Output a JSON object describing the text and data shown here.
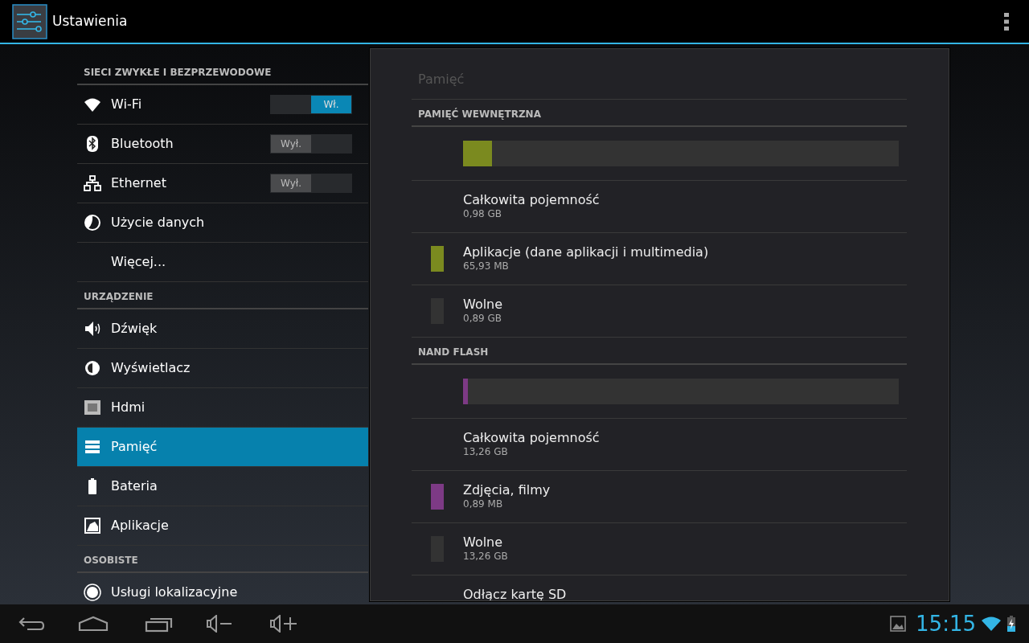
{
  "app_bar": {
    "title": "Ustawienia"
  },
  "sidebar": {
    "sections": [
      {
        "header": "SIECI ZWYKŁE I BEZPRZEWODOWE",
        "items": [
          {
            "label": "Wi-Fi",
            "selected": false,
            "toggle": {
              "on": true,
              "label": "Wł."
            }
          },
          {
            "label": "Bluetooth",
            "selected": false,
            "toggle": {
              "on": false,
              "label": "Wył."
            }
          },
          {
            "label": "Ethernet",
            "selected": false,
            "toggle": {
              "on": false,
              "label": "Wył."
            }
          },
          {
            "label": "Użycie danych",
            "selected": false
          },
          {
            "label": "Więcej...",
            "selected": false
          }
        ]
      },
      {
        "header": "URZĄDZENIE",
        "items": [
          {
            "label": "Dźwięk",
            "selected": false
          },
          {
            "label": "Wyświetlacz",
            "selected": false
          },
          {
            "label": "Hdmi",
            "selected": false
          },
          {
            "label": "Pamięć",
            "selected": true
          },
          {
            "label": "Bateria",
            "selected": false
          },
          {
            "label": "Aplikacje",
            "selected": false
          }
        ]
      },
      {
        "header": "OSOBISTE",
        "items": [
          {
            "label": "Usługi lokalizacyjne",
            "selected": false
          }
        ]
      }
    ]
  },
  "detail": {
    "title": "Pamięć",
    "sections": [
      {
        "header": "PAMIĘĆ WEWNĘTRZNA",
        "bar": {
          "level": 0.066,
          "color": "#7b8a1f"
        },
        "rows": [
          {
            "label": "Całkowita pojemność",
            "value": "0,98 GB"
          },
          {
            "label": "Aplikacje (dane aplikacji i multimedia)",
            "value": "65,93 MB",
            "color": "#7b8a1f"
          },
          {
            "label": "Wolne",
            "value": "0,89 GB",
            "color": "#333333"
          }
        ]
      },
      {
        "header": "NAND FLASH",
        "bar": {
          "level": 0.011,
          "color": "#7d3a85"
        },
        "rows": [
          {
            "label": "Całkowita pojemność",
            "value": "13,26 GB"
          },
          {
            "label": "Zdjęcia, filmy",
            "value": "0,89 MB",
            "color": "#7d3a85"
          },
          {
            "label": "Wolne",
            "value": "13,26 GB",
            "color": "#333333"
          }
        ]
      }
    ],
    "footer_item": "Odłącz kartę SD"
  },
  "status_bar": {
    "time": "15:15"
  }
}
